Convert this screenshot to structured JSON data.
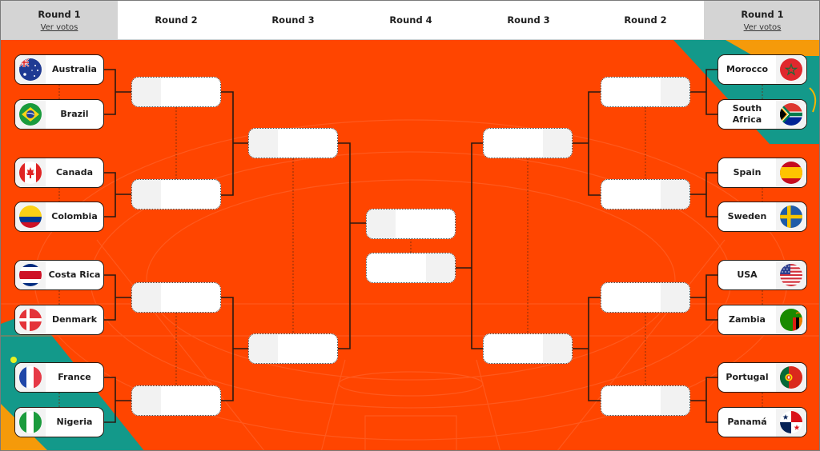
{
  "header": {
    "columns": [
      {
        "label": "Round 1",
        "link": "Ver votos"
      },
      {
        "label": "Round 2"
      },
      {
        "label": "Round 3"
      },
      {
        "label": "Round 4"
      },
      {
        "label": "Round 3"
      },
      {
        "label": "Round 2"
      },
      {
        "label": "Round 1",
        "link": "Ver votos"
      }
    ]
  },
  "colors": {
    "board": "#ff4500",
    "teal": "#13998a",
    "amber": "#f59a0a",
    "round1_header": "#d4d4d4"
  },
  "left_teams": [
    {
      "name": "Australia",
      "flag": "australia-flag"
    },
    {
      "name": "Brazil",
      "flag": "brazil-flag"
    },
    {
      "name": "Canada",
      "flag": "canada-flag"
    },
    {
      "name": "Colombia",
      "flag": "colombia-flag"
    },
    {
      "name": "Costa Rica",
      "flag": "costa-rica-flag"
    },
    {
      "name": "Denmark",
      "flag": "denmark-flag"
    },
    {
      "name": "France",
      "flag": "france-flag"
    },
    {
      "name": "Nigeria",
      "flag": "nigeria-flag"
    }
  ],
  "right_teams": [
    {
      "name": "Morocco",
      "flag": "morocco-flag"
    },
    {
      "name": "South Africa",
      "flag": "south-africa-flag"
    },
    {
      "name": "Spain",
      "flag": "spain-flag"
    },
    {
      "name": "Sweden",
      "flag": "sweden-flag"
    },
    {
      "name": "USA",
      "flag": "usa-flag"
    },
    {
      "name": "Zambia",
      "flag": "zambia-flag"
    },
    {
      "name": "Portugal",
      "flag": "portugal-flag"
    },
    {
      "name": "Panamá",
      "flag": "panama-flag"
    }
  ]
}
